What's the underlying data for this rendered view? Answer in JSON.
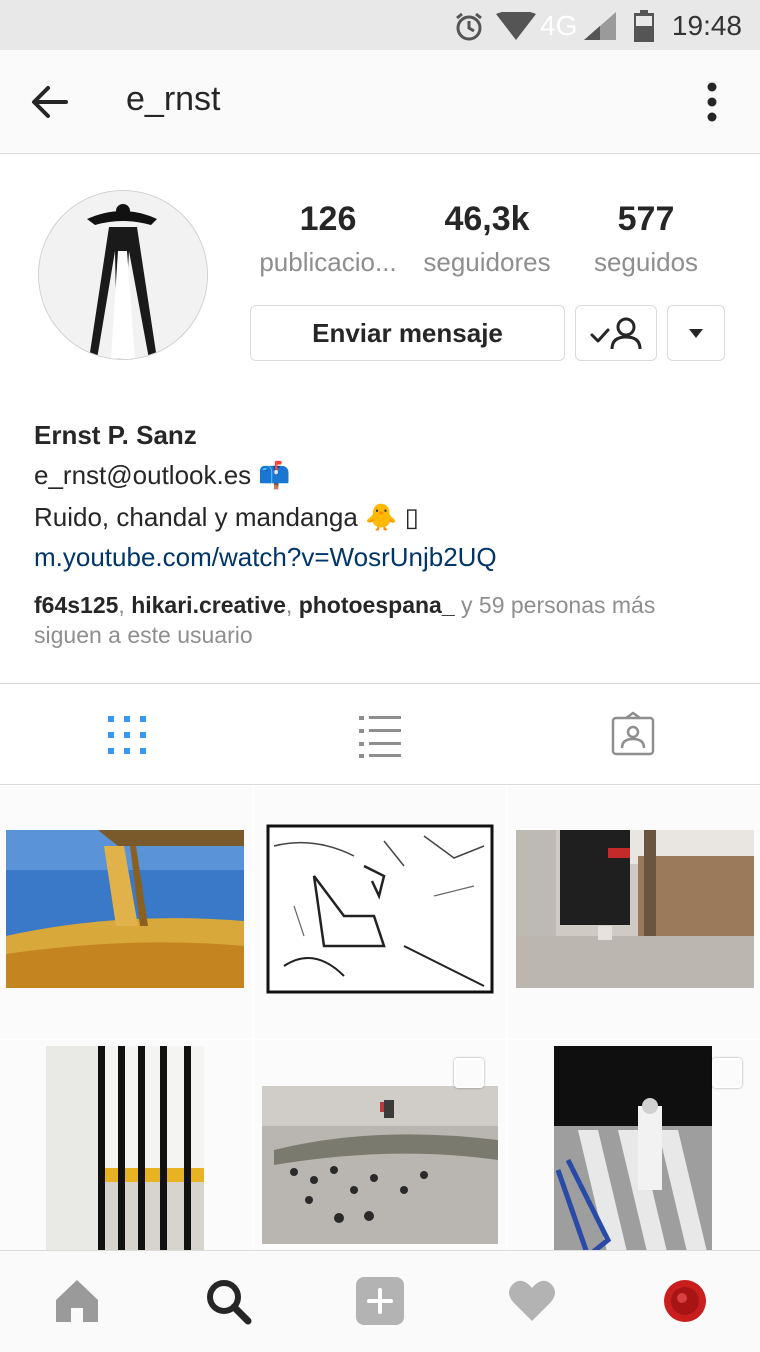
{
  "status_bar": {
    "time": "19:48",
    "network": "4G"
  },
  "header": {
    "username": "e_rnst"
  },
  "profile": {
    "stats": [
      {
        "value": "126",
        "label": "publicacio..."
      },
      {
        "value": "46,3k",
        "label": "seguidores"
      },
      {
        "value": "577",
        "label": "seguidos"
      }
    ],
    "message_button": "Enviar mensaje",
    "full_name": "Ernst P. Sanz",
    "bio_line1": "e_rnst@outlook.es 📫",
    "bio_line2": "Ruido, chandal y mandanga 🐥 ▯",
    "link": "m.youtube.com/watch?v=WosrUnjb2UQ",
    "followed_by": {
      "users": [
        "f64s125",
        "hikari.creative",
        "photoespana_"
      ],
      "rest": " y 59 personas más siguen a este usuario"
    }
  },
  "tabs": [
    "grid-view",
    "list-view",
    "tagged-view"
  ],
  "colors": {
    "accent": "#3897f0",
    "link": "#003569",
    "muted": "#8e8e8e"
  },
  "bottom_nav": [
    "home",
    "search",
    "add",
    "activity",
    "profile"
  ]
}
